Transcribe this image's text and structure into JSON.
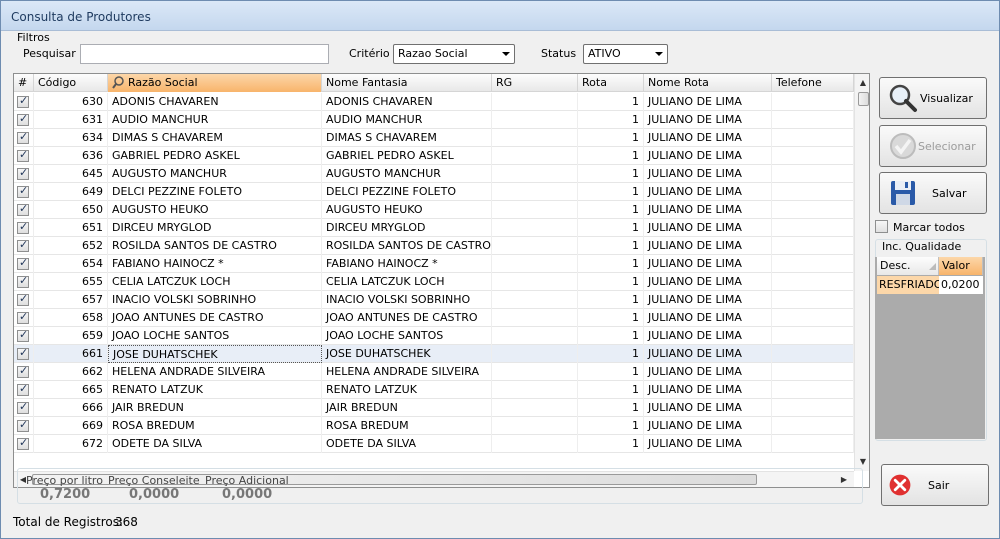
{
  "window": {
    "title": "Consulta de Produtores"
  },
  "filters": {
    "group_label": "Filtros",
    "search_label": "Pesquisar",
    "search_value": "",
    "criteria_label": "Critério",
    "criteria_value": "Razao Social",
    "status_label": "Status",
    "status_value": "ATIVO"
  },
  "grid": {
    "headers": [
      "#",
      "Código",
      "Razão Social",
      "Nome Fantasia",
      "RG",
      "Rota",
      "Nome Rota",
      "Telefone"
    ],
    "rows": [
      {
        "codigo": "630",
        "razao": "ADONIS CHAVAREN",
        "fantasia": "ADONIS CHAVAREN",
        "rg": "",
        "rota": "1",
        "nome_rota": "JULIANO DE LIMA",
        "telefone": ""
      },
      {
        "codigo": "631",
        "razao": "AUDIO MANCHUR",
        "fantasia": "AUDIO MANCHUR",
        "rg": "",
        "rota": "1",
        "nome_rota": "JULIANO DE LIMA",
        "telefone": ""
      },
      {
        "codigo": "634",
        "razao": "DIMAS S CHAVAREM",
        "fantasia": "DIMAS S CHAVAREM",
        "rg": "",
        "rota": "1",
        "nome_rota": "JULIANO DE LIMA",
        "telefone": ""
      },
      {
        "codigo": "636",
        "razao": "GABRIEL PEDRO ASKEL",
        "fantasia": "GABRIEL PEDRO ASKEL",
        "rg": "",
        "rota": "1",
        "nome_rota": "JULIANO DE LIMA",
        "telefone": ""
      },
      {
        "codigo": "645",
        "razao": "AUGUSTO MANCHUR",
        "fantasia": "AUGUSTO MANCHUR",
        "rg": "",
        "rota": "1",
        "nome_rota": "JULIANO DE LIMA",
        "telefone": ""
      },
      {
        "codigo": "649",
        "razao": "DELCI PEZZINE FOLETO",
        "fantasia": "DELCI PEZZINE FOLETO",
        "rg": "",
        "rota": "1",
        "nome_rota": "JULIANO DE LIMA",
        "telefone": ""
      },
      {
        "codigo": "650",
        "razao": "AUGUSTO HEUKO",
        "fantasia": "AUGUSTO HEUKO",
        "rg": "",
        "rota": "1",
        "nome_rota": "JULIANO DE LIMA",
        "telefone": ""
      },
      {
        "codigo": "651",
        "razao": "DIRCEU MRYGLOD",
        "fantasia": "DIRCEU MRYGLOD",
        "rg": "",
        "rota": "1",
        "nome_rota": "JULIANO DE LIMA",
        "telefone": ""
      },
      {
        "codigo": "652",
        "razao": "ROSILDA SANTOS DE CASTRO",
        "fantasia": "ROSILDA SANTOS DE CASTRO",
        "rg": "",
        "rota": "1",
        "nome_rota": "JULIANO DE LIMA",
        "telefone": ""
      },
      {
        "codigo": "654",
        "razao": "FABIANO HAINOCZ *",
        "fantasia": "FABIANO HAINOCZ *",
        "rg": "",
        "rota": "1",
        "nome_rota": "JULIANO DE LIMA",
        "telefone": ""
      },
      {
        "codigo": "655",
        "razao": "CELIA LATCZUK LOCH",
        "fantasia": "CELIA LATCZUK LOCH",
        "rg": "",
        "rota": "1",
        "nome_rota": "JULIANO DE LIMA",
        "telefone": ""
      },
      {
        "codigo": "657",
        "razao": "INACIO VOLSKI SOBRINHO",
        "fantasia": "INACIO VOLSKI SOBRINHO",
        "rg": "",
        "rota": "1",
        "nome_rota": "JULIANO DE LIMA",
        "telefone": ""
      },
      {
        "codigo": "658",
        "razao": "JOAO ANTUNES DE CASTRO",
        "fantasia": "JOAO ANTUNES DE CASTRO",
        "rg": "",
        "rota": "1",
        "nome_rota": "JULIANO DE LIMA",
        "telefone": ""
      },
      {
        "codigo": "659",
        "razao": "JOAO LOCHE SANTOS",
        "fantasia": "JOAO LOCHE SANTOS",
        "rg": "",
        "rota": "1",
        "nome_rota": "JULIANO DE LIMA",
        "telefone": ""
      },
      {
        "codigo": "661",
        "razao": "JOSE DUHATSCHEK",
        "fantasia": "JOSE DUHATSCHEK",
        "rg": "",
        "rota": "1",
        "nome_rota": "JULIANO DE LIMA",
        "telefone": ""
      },
      {
        "codigo": "662",
        "razao": "HELENA ANDRADE SILVEIRA",
        "fantasia": "HELENA ANDRADE SILVEIRA",
        "rg": "",
        "rota": "1",
        "nome_rota": "JULIANO DE LIMA",
        "telefone": ""
      },
      {
        "codigo": "665",
        "razao": "RENATO LATZUK",
        "fantasia": "RENATO LATZUK",
        "rg": "",
        "rota": "1",
        "nome_rota": "JULIANO DE LIMA",
        "telefone": ""
      },
      {
        "codigo": "666",
        "razao": "JAIR BREDUN",
        "fantasia": "JAIR BREDUN",
        "rg": "",
        "rota": "1",
        "nome_rota": "JULIANO DE LIMA",
        "telefone": ""
      },
      {
        "codigo": "669",
        "razao": "ROSA BREDUM",
        "fantasia": "ROSA BREDUM",
        "rg": "",
        "rota": "1",
        "nome_rota": "JULIANO DE LIMA",
        "telefone": ""
      },
      {
        "codigo": "672",
        "razao": "ODETE DA SILVA",
        "fantasia": "ODETE DA SILVA",
        "rg": "",
        "rota": "1",
        "nome_rota": "JULIANO DE LIMA",
        "telefone": ""
      }
    ],
    "selected_row": 14
  },
  "buttons": {
    "visualizar": "Visualizar",
    "selecionar": "Selecionar",
    "salvar": "Salvar",
    "sair": "Sair"
  },
  "marcar_todos": "Marcar todos",
  "quality": {
    "title": "Inc. Qualidade",
    "headers": [
      "Desc.",
      "Valor"
    ],
    "rows": [
      {
        "desc": "RESFRIADO",
        "valor": "0,0200"
      }
    ]
  },
  "prices": {
    "litro_label": "Preço por litro",
    "litro_value": "0,7200",
    "conseleite_label": "Preço Conseleite",
    "conseleite_value": "0,0000",
    "adicional_label": "Preço Adicional",
    "adicional_value": "0,0000"
  },
  "footer": {
    "total_label": "Total de Registros:",
    "total_value": "368"
  },
  "colors": {
    "sorted_header": "#f8b46b",
    "quality_highlight": "#fcd7a9",
    "sair_icon": "#e03030"
  }
}
